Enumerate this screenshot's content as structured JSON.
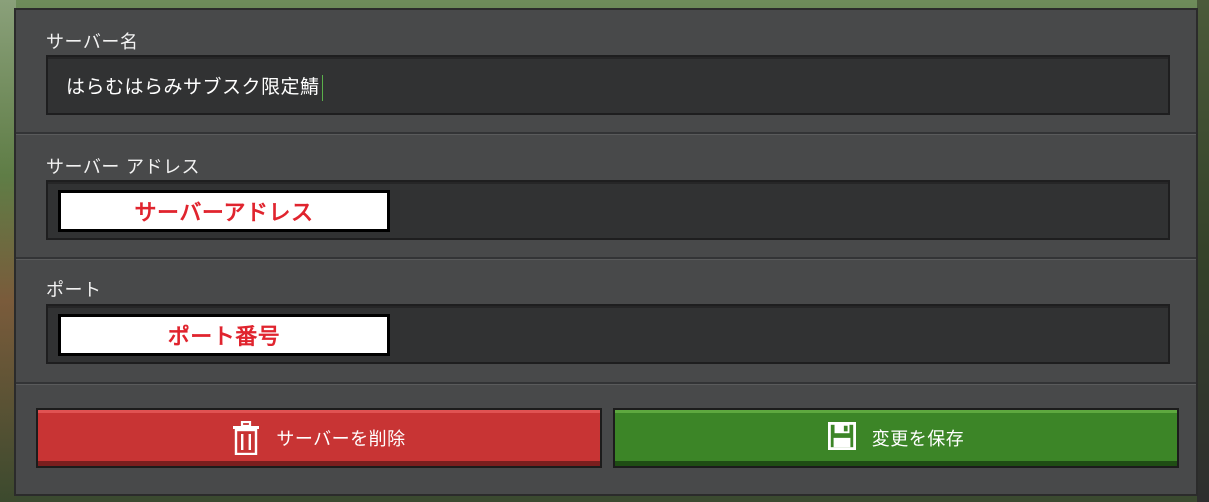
{
  "server_name": {
    "label": "サーバー名",
    "value": "はらむはらみサブスク限定鯖"
  },
  "server_address": {
    "label": "サーバー アドレス",
    "value": "サーバーアドレス"
  },
  "port": {
    "label": "ポート",
    "value": "ポート番号"
  },
  "buttons": {
    "delete_label": "サーバーを削除",
    "delete_icon": "trash-icon",
    "save_label": "変更を保存",
    "save_icon": "floppy-disk-icon"
  },
  "colors": {
    "delete": "#c83434",
    "save": "#3c8527",
    "redaction_text": "#e0242e"
  }
}
